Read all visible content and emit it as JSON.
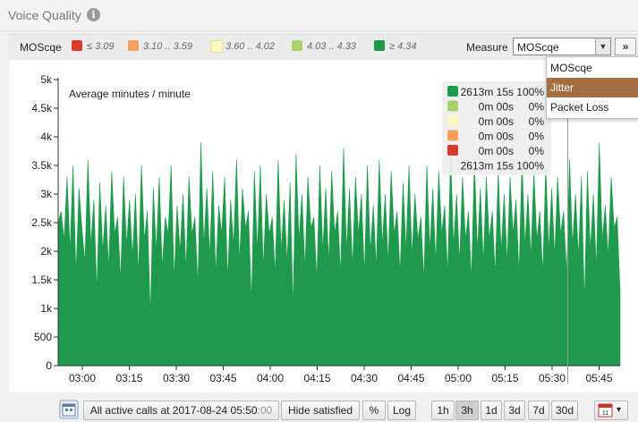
{
  "title": "Voice Quality",
  "info_icon": "i",
  "legend": {
    "label": "MOScqe",
    "items": [
      {
        "text": "≤ 3.09",
        "color": "#d93a2e"
      },
      {
        "text": "3.10 .. 3.59",
        "color": "#f5a05b"
      },
      {
        "text": "3.60 .. 4.02",
        "color": "#fdf7c2"
      },
      {
        "text": "4.03 .. 4.33",
        "color": "#a8d26a"
      },
      {
        "text": "≥ 4.34",
        "color": "#1f9a4c"
      }
    ]
  },
  "measure": {
    "label": "Measure",
    "value": "MOScqe",
    "go_icon": "»",
    "options": [
      "MOScqe",
      "Jitter",
      "Packet Loss"
    ],
    "highlighted": "Jitter"
  },
  "tooltip": {
    "rows": [
      {
        "color": "#1f9a4c",
        "time": "2613m 15s",
        "pct": "100%"
      },
      {
        "color": "#a8d26a",
        "time": "0m 00s",
        "pct": "0%"
      },
      {
        "color": "#fdf7c2",
        "time": "0m 00s",
        "pct": "0%"
      },
      {
        "color": "#f5a05b",
        "time": "0m 00s",
        "pct": "0%"
      },
      {
        "color": "#d93a2e",
        "time": "0m 00s",
        "pct": "0%"
      }
    ],
    "total_time": "2613m 15s",
    "total_pct": "100%"
  },
  "chart_data": {
    "type": "area",
    "annotation": "Average minutes / minute",
    "ylim": [
      0,
      5000
    ],
    "y_ticks": [
      "0",
      "500",
      "1k",
      "1.5k",
      "2k",
      "2.5k",
      "3k",
      "3.5k",
      "4k",
      "4.5k",
      "5k"
    ],
    "x_ticks": [
      "03:00",
      "03:15",
      "03:30",
      "03:45",
      "04:00",
      "04:15",
      "04:30",
      "04:45",
      "05:00",
      "05:15",
      "05:30",
      "05:45"
    ],
    "series": [
      {
        "color": "#1f9a4c",
        "values": [
          2500,
          2700,
          2200,
          3300,
          2000,
          3500,
          1600,
          3100,
          2400,
          1800,
          3600,
          2100,
          2900,
          1300,
          3200,
          2000,
          2800,
          1700,
          3400,
          2300,
          2600,
          1500,
          3300,
          2100,
          2900,
          1900,
          3000,
          1600,
          3500,
          2200,
          2700,
          870,
          3100,
          2000,
          3300,
          1700,
          2600,
          2300,
          3500,
          1500,
          2800,
          2000,
          3000,
          1700,
          3300,
          2300,
          2600,
          1400,
          3900,
          2100,
          3100,
          1900,
          3400,
          1600,
          2800,
          2300,
          3300,
          1500,
          2900,
          2100,
          3600,
          1800,
          3100,
          2400,
          2700,
          1100,
          3400,
          2000,
          3500,
          1700,
          3000,
          2300,
          2600,
          1600,
          3600,
          2000,
          2900,
          1800,
          3200,
          1000,
          3700,
          2200,
          3000,
          1700,
          3300,
          2400,
          2600,
          1500,
          3500,
          2000,
          3100,
          1800,
          3400,
          2300,
          2700,
          1600,
          3800,
          2000,
          3100,
          1700,
          3300,
          2300,
          3000,
          1600,
          3500,
          2000,
          2800,
          1700,
          3600,
          2100,
          3000,
          1800,
          3400,
          2300,
          2700,
          1600,
          3200,
          2000,
          3500,
          1900,
          3000,
          2200,
          2600,
          1500,
          3500,
          2000,
          3100,
          1800,
          3400,
          2300,
          2800,
          1600,
          3700,
          2100,
          3000,
          1800,
          3300,
          2200,
          2700,
          1500,
          3600,
          2000,
          3100,
          1800,
          3300,
          2200,
          2700,
          1600,
          3400,
          2000,
          3000,
          1800,
          3300,
          2300,
          2900,
          1600,
          3600,
          2100,
          3000,
          1900,
          3400,
          2200,
          2700,
          1600,
          3500,
          2000,
          3100,
          1900,
          3300,
          2300,
          2700,
          1600,
          3600,
          2100,
          3000,
          1900,
          3300,
          1100,
          3400,
          2000,
          3000,
          1700,
          3900,
          2200,
          2800,
          1900,
          3300,
          2400,
          2600,
          1300
        ]
      }
    ],
    "marker_time": "05:35"
  },
  "toolbar": {
    "calendar_icon": "calendar-icon",
    "all_calls_prefix": "All active calls at 2017-08-24 05:50",
    "all_calls_suffix": ":00",
    "hide_satisfied": "Hide satisfied",
    "percent": "%",
    "log": "Log",
    "ranges": [
      "1h",
      "3h",
      "1d",
      "3d",
      "7d",
      "30d"
    ],
    "active_range": "3h",
    "date_picker_day": "11",
    "date_picker_arrow": "▾"
  }
}
